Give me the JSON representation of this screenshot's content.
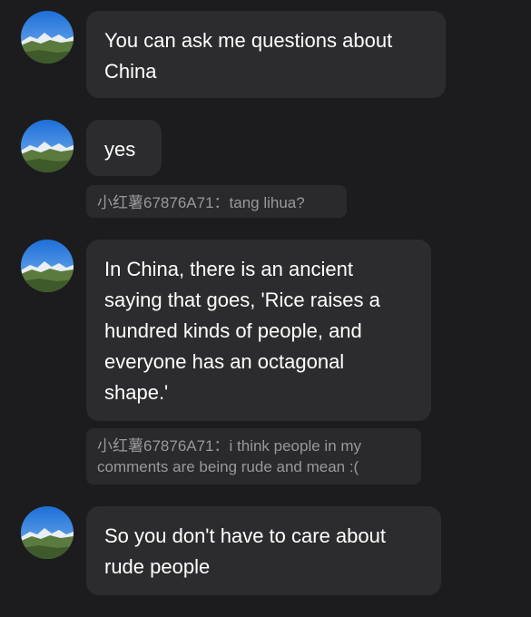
{
  "colors": {
    "background": "#1c1c1e",
    "bubble": "#2c2c2e",
    "bubble_text": "#ffffff",
    "quote_bg": "#2a2a2c",
    "quote_text": "#98989d"
  },
  "avatar_icon": "mountain-landscape-avatar",
  "messages": [
    {
      "lines": [
        "You can ask me questions about",
        "China"
      ]
    },
    {
      "lines": [
        "yes"
      ]
    },
    {
      "lines": [
        "In China, there is an ancient",
        "saying that goes, 'Rice raises a",
        "hundred kinds of people, and",
        "everyone has an octagonal",
        "shape.'"
      ]
    },
    {
      "lines": [
        "So you don't have to care about",
        "rude people"
      ]
    }
  ],
  "quotes": [
    {
      "lines": [
        "小红薯67876A71：tang lihua?"
      ]
    },
    {
      "lines": [
        "小红薯67876A71：i think people in my",
        "comments are being rude and mean :("
      ]
    }
  ]
}
